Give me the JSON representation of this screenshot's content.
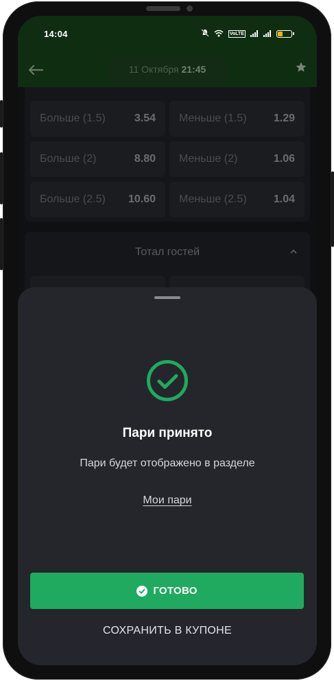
{
  "status_bar": {
    "time": "14:04",
    "volte_label": "VoLTE",
    "battery_level": 0.35,
    "battery_color": "#f2b400"
  },
  "app_bar": {
    "back_icon": "arrow-left-icon",
    "date": "11 Октября",
    "time": "21:45",
    "favorite_icon": "star-icon"
  },
  "markets": {
    "total_rows": [
      {
        "left_label": "Больше (1.5)",
        "left_odd": "3.54",
        "right_label": "Меньше (1.5)",
        "right_odd": "1.29"
      },
      {
        "left_label": "Больше (2)",
        "left_odd": "8.80",
        "right_label": "Меньше (2)",
        "right_odd": "1.06"
      },
      {
        "left_label": "Больше (2.5)",
        "left_odd": "10.60",
        "right_label": "Меньше (2.5)",
        "right_odd": "1.04"
      }
    ],
    "guest_total_header": "Тотал гостей",
    "guest_total_chevron": "chevron-up-icon"
  },
  "sheet": {
    "title": "Пари принято",
    "text": "Пари будет отображено в разделе",
    "link": "Мои пари",
    "done_button": "ГОТОВО",
    "save_button": "СОХРАНИТЬ В КУПОНЕ",
    "success_color": "#1faa5f",
    "success_icon": "check-circle-icon"
  }
}
